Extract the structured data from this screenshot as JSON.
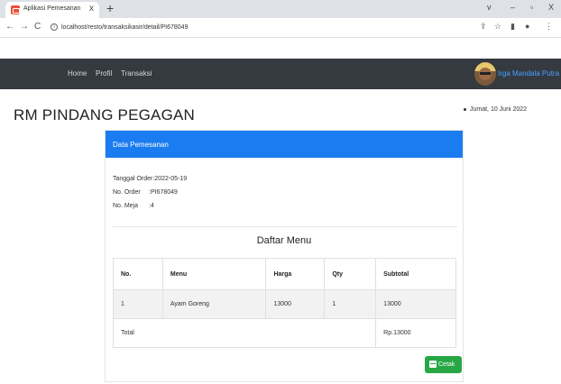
{
  "browser": {
    "tab_title": "Aplikasi Pemesanan",
    "tab_close": "x",
    "new_tab": "+",
    "url": "localhost/resto/transaksikasir/detail/PI678049",
    "win": {
      "chevron": "v",
      "minimize": "–",
      "maximize": "▫",
      "close": "X"
    },
    "nav": {
      "back": "←",
      "forward": "→",
      "reload": "C"
    },
    "tools": {
      "share": "⇪",
      "star": "☆",
      "sidebar": "▮",
      "profile": "●",
      "menu": "⋮"
    }
  },
  "navbar": {
    "links": [
      "Home",
      "Profil",
      "Transaksi"
    ],
    "user_name": "Irga Mandala Putra"
  },
  "page": {
    "title": "RM PINDANG PEGAGAN",
    "date": "Jumat, 10 Juni 2022"
  },
  "card": {
    "header": "Data Pemesanan",
    "order_date_label": "Tanggal Order",
    "order_date_value": ":2022-05-19",
    "order_no_label": "No. Order",
    "order_no_value": ":PI678049",
    "table_no_label": "No. Meja",
    "table_no_value": ":4",
    "table_title": "Daftar Menu",
    "columns": [
      "No.",
      "Menu",
      "Harga",
      "Qty",
      "Subtotal"
    ],
    "rows": [
      {
        "no": "1",
        "menu": "Ayam Goreng",
        "harga": "13000",
        "qty": "1",
        "subtotal": "13000"
      }
    ],
    "total_label": "Total",
    "total_value": "Rp.13000",
    "print_label": "Cetak"
  },
  "colors": {
    "navbar_bg": "#343a40",
    "card_header": "#1a7cf0",
    "print_button": "#28a745",
    "username": "#4aa0ff"
  }
}
